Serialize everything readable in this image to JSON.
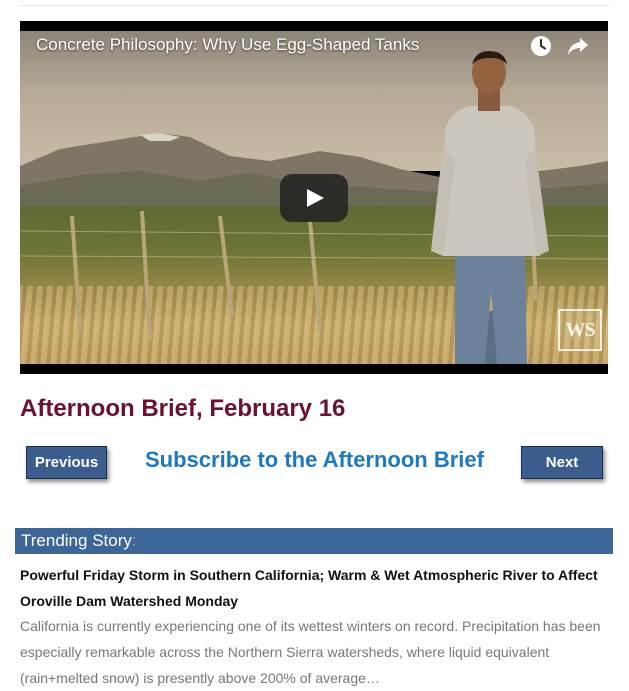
{
  "video": {
    "title": "Concrete Philosophy: Why Use Egg-Shaped Tanks",
    "watermark": "WS",
    "icons": [
      "clock-icon",
      "share-icon",
      "play-icon"
    ]
  },
  "brief": {
    "title": "Afternoon Brief, February 16"
  },
  "nav": {
    "previous_label": "Previous",
    "next_label": "Next",
    "subscribe_label": "Subscribe to the Afternoon Brief"
  },
  "trending": {
    "label": "Trending Story",
    "separator": ":",
    "headline": "Powerful Friday Storm in Southern California; Warm & Wet Atmospheric River to Affect Oroville Dam Watershed Monday",
    "excerpt": "California is currently experiencing one of its wettest winters on record. Precipitation has been especially remarkable across the Northern Sierra watersheds, where liquid equivalent (rain+melted snow) is presently above 200% of average…"
  },
  "colors": {
    "title": "#6b1133",
    "button_bg": "#3b5d8d",
    "link": "#1d78c1",
    "trending_bar": "#3d6698"
  }
}
